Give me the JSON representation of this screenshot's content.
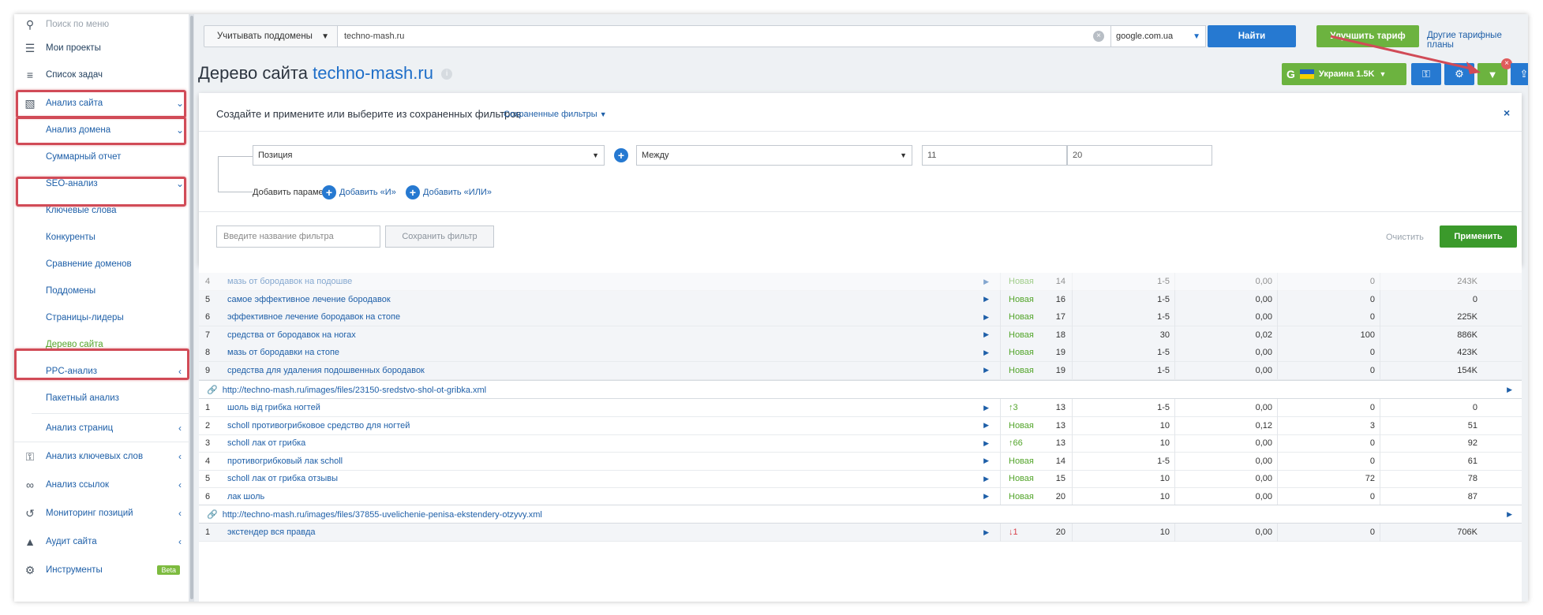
{
  "sidebar": {
    "search_placeholder": "Поиск по меню",
    "items": [
      {
        "label": "Мои проекты"
      },
      {
        "label": "Список задач"
      },
      {
        "label": "Анализ сайта"
      },
      {
        "label": "Анализ домена"
      },
      {
        "label": "Суммарный отчет"
      },
      {
        "label": "SEO-анализ"
      },
      {
        "label": "Ключевые слова"
      },
      {
        "label": "Конкуренты"
      },
      {
        "label": "Сравнение доменов"
      },
      {
        "label": "Поддомены"
      },
      {
        "label": "Страницы-лидеры"
      },
      {
        "label": "Дерево сайта"
      },
      {
        "label": "PPC-анализ"
      },
      {
        "label": "Пакетный анализ"
      },
      {
        "label": "Анализ страниц"
      },
      {
        "label": "Анализ ключевых слов"
      },
      {
        "label": "Анализ ссылок"
      },
      {
        "label": "Мониторинг позиций"
      },
      {
        "label": "Аудит сайта"
      },
      {
        "label": "Инструменты"
      }
    ],
    "beta_badge": "Beta"
  },
  "topbar": {
    "subdomains_label": "Учитывать поддомены",
    "url_value": "techno-mash.ru",
    "engine_value": "google.com.ua",
    "find_label": "Найти",
    "upgrade_label": "Улучшить тариф",
    "other_plans_label": "Другие тарифные планы"
  },
  "page": {
    "title": "Дерево сайта",
    "domain": "techno-mash.ru",
    "region_label": "Украина 1.5K",
    "region_engine_letter": "G"
  },
  "filter": {
    "title": "Создайте и примените или выберите из сохраненных фильтров",
    "saved_filters_label": "Сохраненные фильтры",
    "field_value": "Позиция",
    "condition_value": "Между",
    "from_value": "11",
    "to_value": "20",
    "add_param_label": "Добавить параметр:",
    "add_and_label": "Добавить «И»",
    "add_or_label": "Добавить «ИЛИ»",
    "name_placeholder": "Введите название фильтра",
    "save_label": "Сохранить фильтр",
    "clear_label": "Очистить",
    "apply_label": "Применить"
  },
  "table": {
    "group1_rows": [
      {
        "num": "4",
        "kw": "мазь от бородавок на подошве",
        "pos": "Новая",
        "p": "14",
        "c1": "1-5",
        "c2": "0,00",
        "c3": "0",
        "c4": "243K"
      },
      {
        "num": "5",
        "kw": "самое эффективное лечение бородавок",
        "pos": "Новая",
        "p": "16",
        "c1": "1-5",
        "c2": "0,00",
        "c3": "0",
        "c4": "0"
      },
      {
        "num": "6",
        "kw": "эффективное лечение бородавок на стопе",
        "pos": "Новая",
        "p": "17",
        "c1": "1-5",
        "c2": "0,00",
        "c3": "0",
        "c4": "225K"
      },
      {
        "num": "7",
        "kw": "средства от бородавок на ногах",
        "pos": "Новая",
        "p": "18",
        "c1": "30",
        "c2": "0,02",
        "c3": "100",
        "c4": "886K"
      },
      {
        "num": "8",
        "kw": "мазь от бородавки на стопе",
        "pos": "Новая",
        "p": "19",
        "c1": "1-5",
        "c2": "0,00",
        "c3": "0",
        "c4": "423K"
      },
      {
        "num": "9",
        "kw": "средства для удаления подошвенных бородавок",
        "pos": "Новая",
        "p": "19",
        "c1": "1-5",
        "c2": "0,00",
        "c3": "0",
        "c4": "154K"
      }
    ],
    "url2": "http://techno-mash.ru/images/files/23150-sredstvo-shol-ot-gribka.xml",
    "group2_rows": [
      {
        "num": "1",
        "kw": "шоль від грибка ногтей",
        "pos": "↑3",
        "p": "13",
        "c1": "1-5",
        "c2": "0,00",
        "c3": "0",
        "c4": "0"
      },
      {
        "num": "2",
        "kw": "scholl противогрибковое средство для ногтей",
        "pos": "Новая",
        "p": "13",
        "c1": "10",
        "c2": "0,12",
        "c3": "3",
        "c4": "51"
      },
      {
        "num": "3",
        "kw": "scholl лак от грибка",
        "pos": "↑66",
        "p": "13",
        "c1": "10",
        "c2": "0,00",
        "c3": "0",
        "c4": "92"
      },
      {
        "num": "4",
        "kw": "противогрибковый лак scholl",
        "pos": "Новая",
        "p": "14",
        "c1": "1-5",
        "c2": "0,00",
        "c3": "0",
        "c4": "61"
      },
      {
        "num": "5",
        "kw": "scholl лак от грибка отзывы",
        "pos": "Новая",
        "p": "15",
        "c1": "10",
        "c2": "0,00",
        "c3": "72",
        "c4": "78"
      },
      {
        "num": "6",
        "kw": "лак шоль",
        "pos": "Новая",
        "p": "20",
        "c1": "10",
        "c2": "0,00",
        "c3": "0",
        "c4": "87"
      }
    ],
    "url3": "http://techno-mash.ru/images/files/37855-uvelichenie-penisa-ekstendery-otzyvy.xml",
    "group3_rows": [
      {
        "num": "1",
        "kw": "экстендер вся правда",
        "pos": "↓1",
        "p": "20",
        "c1": "10",
        "c2": "0,00",
        "c3": "0",
        "c4": "706K"
      }
    ]
  },
  "colors": {
    "accent_blue": "#2679d1",
    "accent_green": "#6cb33f",
    "highlight_red": "#d14b57"
  }
}
